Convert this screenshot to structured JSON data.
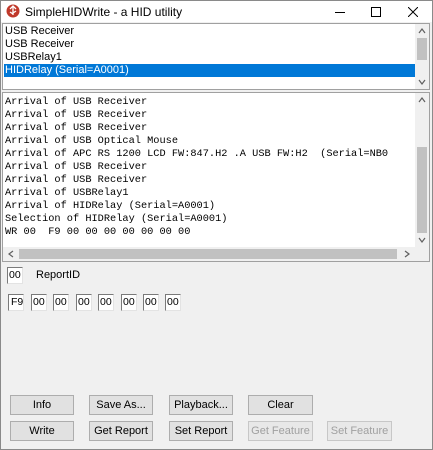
{
  "window": {
    "title": "SimpleHIDWrite - a HID utility",
    "icon": "usb-app-icon"
  },
  "controls": {
    "minimize": "minimize-icon",
    "maximize": "maximize-icon",
    "close": "close-icon"
  },
  "devices": {
    "items": [
      "USB Receiver",
      "USB Receiver",
      "USBRelay1",
      "HIDRelay (Serial=A0001)"
    ],
    "selected_index": 3,
    "selection_color": "#0078d7"
  },
  "log": {
    "lines": [
      "Arrival of USB Receiver",
      "Arrival of USB Receiver",
      "Arrival of USB Receiver",
      "Arrival of USB Optical Mouse",
      "Arrival of APC RS 1200 LCD FW:847.H2 .A USB FW:H2  (Serial=NB0",
      "Arrival of USB Receiver",
      "Arrival of USB Receiver",
      "Arrival of USBRelay1",
      "Arrival of HIDRelay (Serial=A0001)",
      "Selection of HIDRelay (Serial=A0001)",
      "WR 00  F9 00 00 00 00 00 00 00"
    ]
  },
  "report": {
    "id_value": "00",
    "id_label": "ReportID",
    "bytes": [
      "F9",
      "00",
      "00",
      "00",
      "00",
      "00",
      "00",
      "00"
    ]
  },
  "buttons": {
    "info": "Info",
    "save_as": "Save As...",
    "playback": "Playback...",
    "clear": "Clear",
    "write": "Write",
    "get_report": "Get Report",
    "set_report": "Set Report",
    "get_feature": "Get Feature",
    "set_feature": "Set Feature"
  }
}
